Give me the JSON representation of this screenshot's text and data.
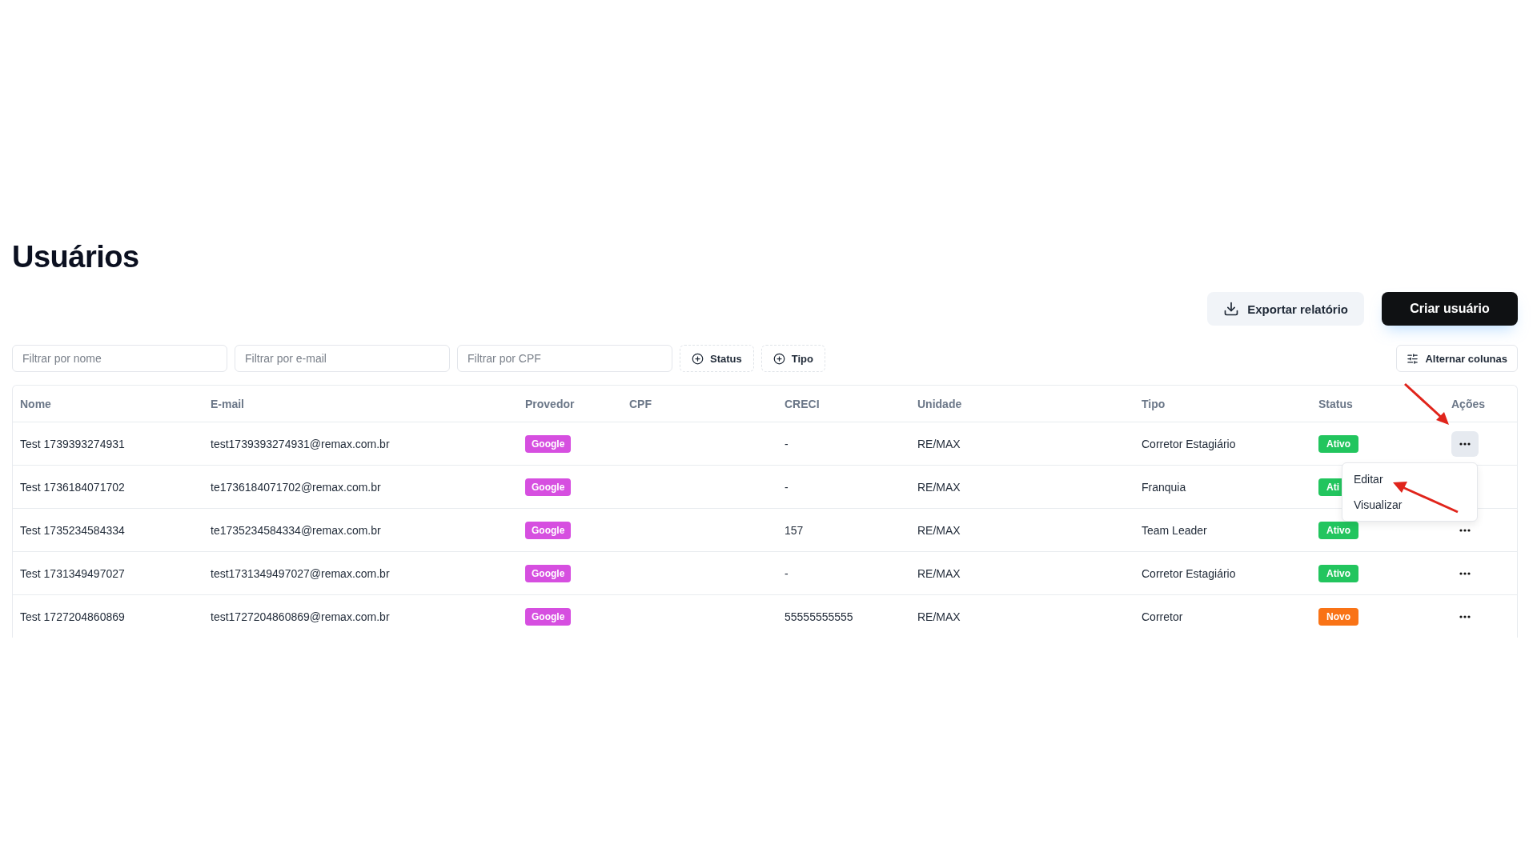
{
  "title": "Usuários",
  "actions": [
    {
      "label": "Exportar relatório",
      "kind": "secondary"
    },
    {
      "label": "Criar usuário",
      "kind": "primary"
    }
  ],
  "filters": [
    {
      "placeholder": "Filtrar por nome"
    },
    {
      "placeholder": "Filtrar por e-mail"
    },
    {
      "placeholder": "Filtrar por CPF"
    }
  ],
  "facets": [
    "Status",
    "Tipo"
  ],
  "columns_button": "Alternar colunas",
  "table": {
    "columns": [
      "Nome",
      "E-mail",
      "Provedor",
      "CPF",
      "CRECI",
      "Unidade",
      "Tipo",
      "Status",
      "Ações"
    ],
    "rows": [
      {
        "nome": "Test 1739393274931",
        "email": "test1739393274931@remax.com.br",
        "provedor": "Google",
        "cpf": "",
        "creci": "-",
        "unidade": "RE/MAX",
        "tipo": "Corretor Estagiário",
        "status": "Ativo",
        "color": "#22c55e",
        "menu_open": true
      },
      {
        "nome": "Test 1736184071702",
        "email": "te1736184071702@remax.com.br",
        "provedor": "Google",
        "cpf": "",
        "creci": "-",
        "unidade": "RE/MAX",
        "tipo": "Franquia",
        "status": "Ati",
        "color": "#22c55e",
        "menu_open": false
      },
      {
        "nome": "Test 1735234584334",
        "email": "te1735234584334@remax.com.br",
        "provedor": "Google",
        "cpf": "",
        "creci": "157",
        "unidade": "RE/MAX",
        "tipo": "Team Leader",
        "status": "Ativo",
        "color": "#22c55e",
        "menu_open": false
      },
      {
        "nome": "Test 1731349497027",
        "email": "test1731349497027@remax.com.br",
        "provedor": "Google",
        "cpf": "",
        "creci": "-",
        "unidade": "RE/MAX",
        "tipo": "Corretor Estagiário",
        "status": "Ativo",
        "color": "#22c55e",
        "menu_open": false
      },
      {
        "nome": "Test 1727204860869",
        "email": "test1727204860869@remax.com.br",
        "provedor": "Google",
        "cpf": "",
        "creci": "55555555555",
        "unidade": "RE/MAX",
        "tipo": "Corretor",
        "status": "Novo",
        "color": "#f97316",
        "menu_open": false
      }
    ]
  },
  "row_menu": [
    "Editar",
    "Visualizar"
  ]
}
